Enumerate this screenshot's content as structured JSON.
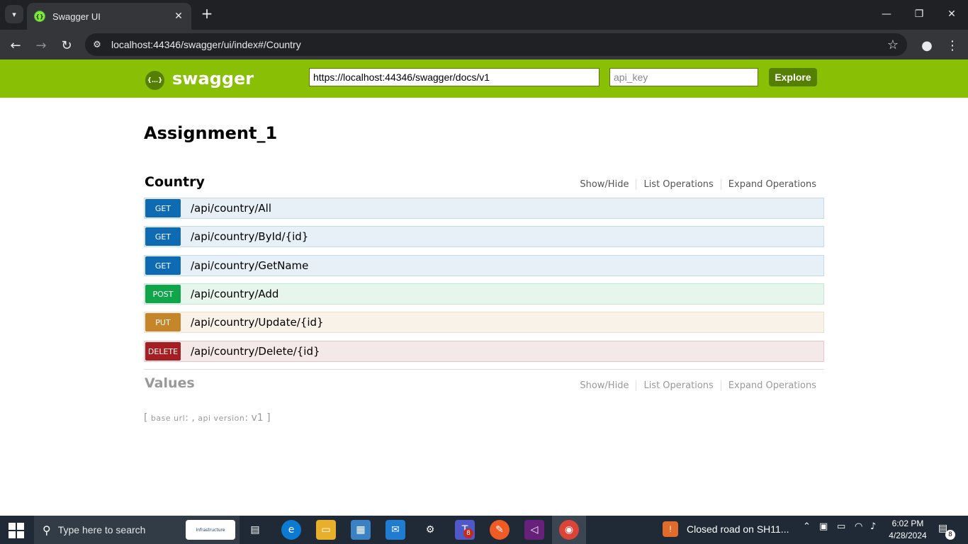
{
  "browser": {
    "tab_title": "Swagger UI",
    "url": "localhost:44346/swagger/ui/index#/Country",
    "icons": {
      "tab_search": "chevron-down-icon",
      "close": "close-icon",
      "new_tab": "plus-icon",
      "back": "back-arrow-icon",
      "forward": "forward-arrow-icon",
      "reload": "reload-icon",
      "site_info": "site-info-icon",
      "bookmark": "star-icon",
      "profile": "profile-icon",
      "menu": "kebab-menu-icon"
    }
  },
  "swagger": {
    "logo_text": "swagger",
    "logo_glyph": "{…}",
    "spec_url": "https://localhost:44346/swagger/docs/v1",
    "api_key_placeholder": "api_key",
    "explore_label": "Explore",
    "accent_color": "#89bf04"
  },
  "api": {
    "title": "Assignment_1",
    "resources": [
      {
        "name": "Country",
        "links": [
          "Show/Hide",
          "List Operations",
          "Expand Operations"
        ],
        "operations": [
          {
            "method": "GET",
            "path": "/api/country/All"
          },
          {
            "method": "GET",
            "path": "/api/country/ById/{id}"
          },
          {
            "method": "GET",
            "path": "/api/country/GetName"
          },
          {
            "method": "POST",
            "path": "/api/country/Add"
          },
          {
            "method": "PUT",
            "path": "/api/country/Update/{id}"
          },
          {
            "method": "DELETE",
            "path": "/api/country/Delete/{id}"
          }
        ]
      },
      {
        "name": "Values",
        "links": [
          "Show/Hide",
          "List Operations",
          "Expand Operations"
        ]
      }
    ],
    "footer": {
      "open": "[",
      "base_url_label": "base url",
      "base_url_value": ": ,",
      "api_version_label": "api version",
      "api_version_value": ": v1",
      "close": "]"
    }
  },
  "taskbar": {
    "search_placeholder": "Type here to search",
    "search_badge": "Infrastructure",
    "weather_text": "Closed road on SH11...",
    "time": "6:02 PM",
    "date": "4/28/2024",
    "teams_badge": "8",
    "notification_count": "8"
  }
}
